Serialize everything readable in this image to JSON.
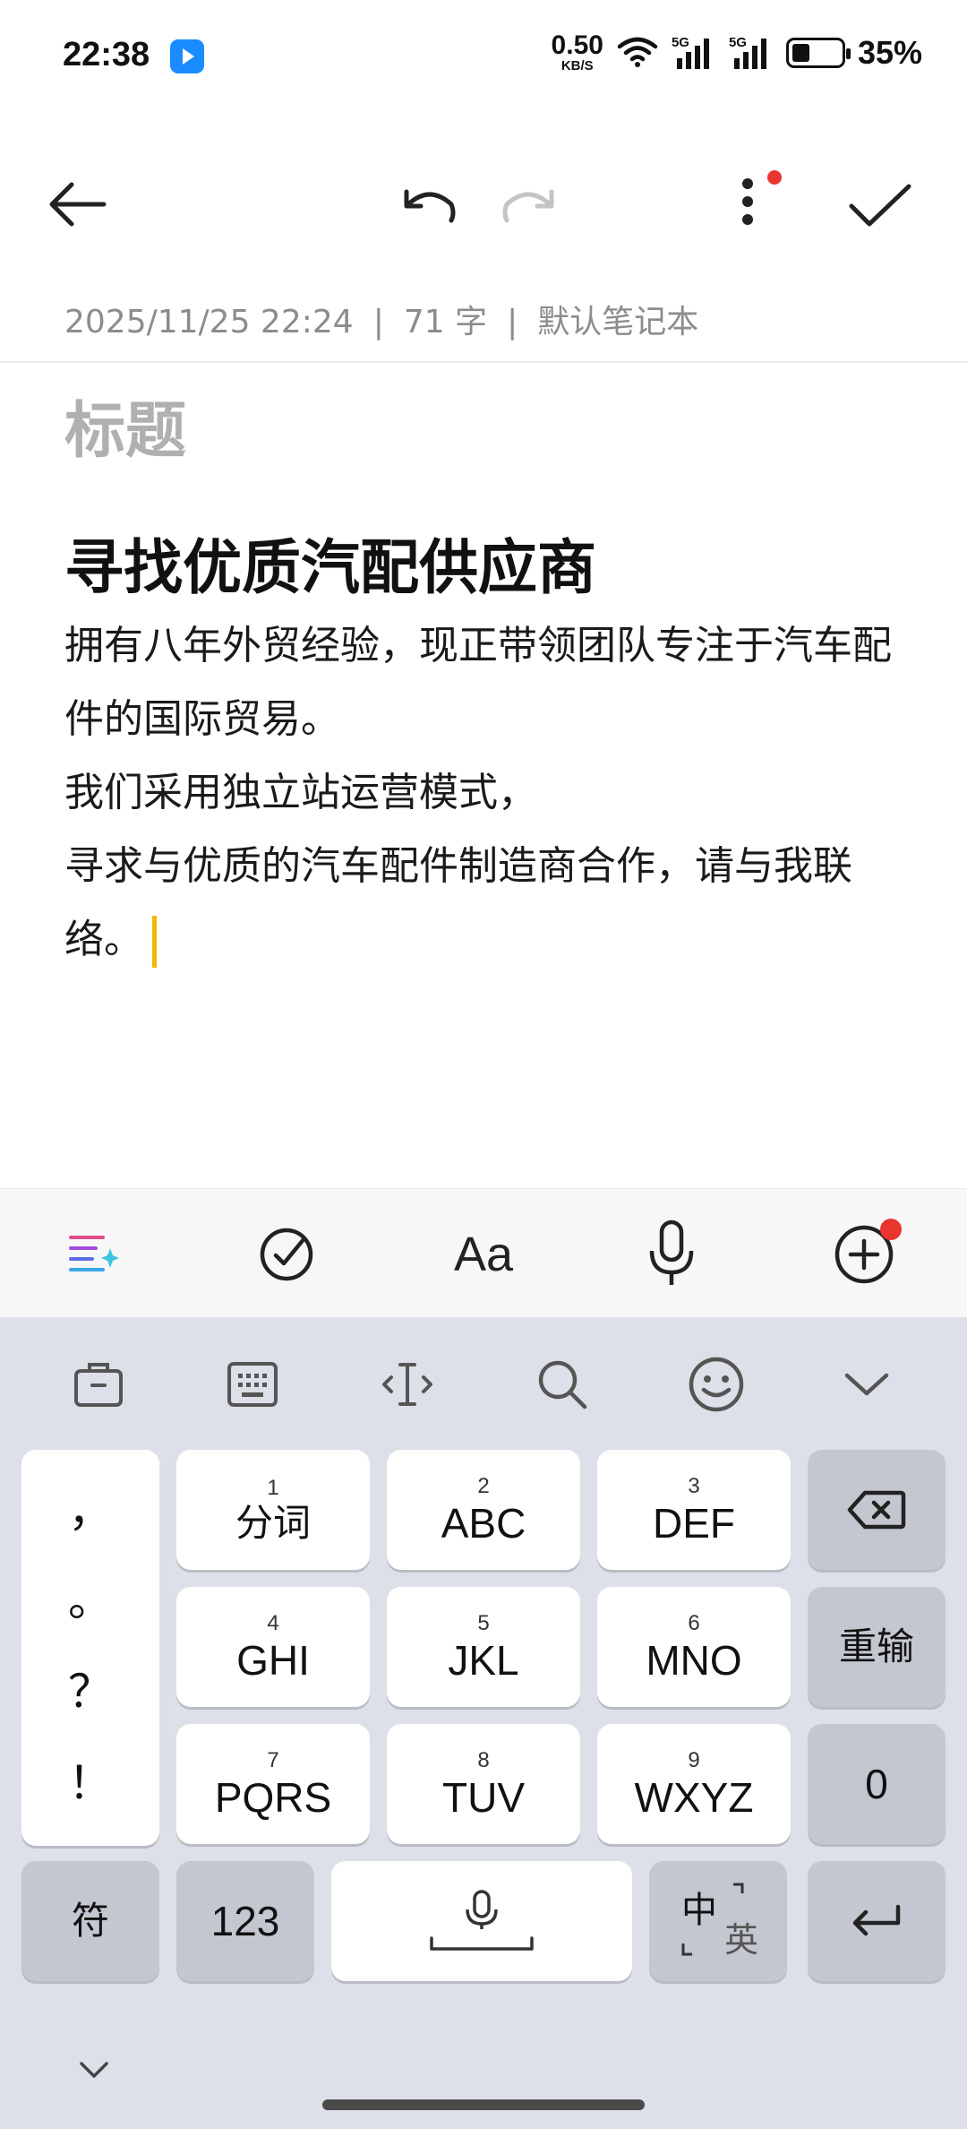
{
  "status_bar": {
    "time": "22:38",
    "net_speed_value": "0.50",
    "net_speed_unit": "KB/S",
    "signal1_label": "5G",
    "signal2_label": "5G",
    "battery_percent": "35%",
    "battery_level": 0.35,
    "icons": [
      "app-badge-icon",
      "wifi-icon",
      "signal-icon",
      "battery-icon"
    ]
  },
  "top_bar": {
    "icons": [
      "back-arrow-icon",
      "undo-icon",
      "redo-icon",
      "more-vertical-icon",
      "check-icon"
    ],
    "accent_dot_color": "#e8352e"
  },
  "note": {
    "datetime": "2025/11/25 22:24",
    "sep": "|",
    "char_count": "71 字",
    "notebook": "默认笔记本",
    "title_placeholder": "标题",
    "heading": "寻找优质汽配供应商",
    "paragraphs": [
      "拥有八年外贸经验，现正带领团队专注于汽车配件的国际贸易。",
      "我们采用独立站运营模式，",
      "寻求与优质的汽车配件制造商合作，请与我联络。"
    ],
    "caret_color": "#f2b705"
  },
  "editor_toolbar": {
    "icons": [
      "ai-format-icon",
      "checklist-icon",
      "text-style-icon",
      "microphone-icon",
      "add-icon"
    ],
    "text_style_label": "Aa"
  },
  "keyboard": {
    "tool_icons": [
      "clipboard-icon",
      "keyboard-icon",
      "cursor-icon",
      "search-icon",
      "emoji-icon",
      "collapse-icon"
    ],
    "punctuation": [
      "，",
      "。",
      "？",
      "！"
    ],
    "keys": [
      {
        "num": "1",
        "label": "分词"
      },
      {
        "num": "2",
        "label": "ABC"
      },
      {
        "num": "3",
        "label": "DEF"
      },
      {
        "num": "4",
        "label": "GHI"
      },
      {
        "num": "5",
        "label": "JKL"
      },
      {
        "num": "6",
        "label": "MNO"
      },
      {
        "num": "7",
        "label": "PQRS"
      },
      {
        "num": "8",
        "label": "TUV"
      },
      {
        "num": "9",
        "label": "WXYZ"
      }
    ],
    "reenter_label": "重输",
    "zero_label": "0",
    "symbol_label": "符",
    "numeric_label": "123",
    "lang_main": "中",
    "lang_alt": "英"
  }
}
